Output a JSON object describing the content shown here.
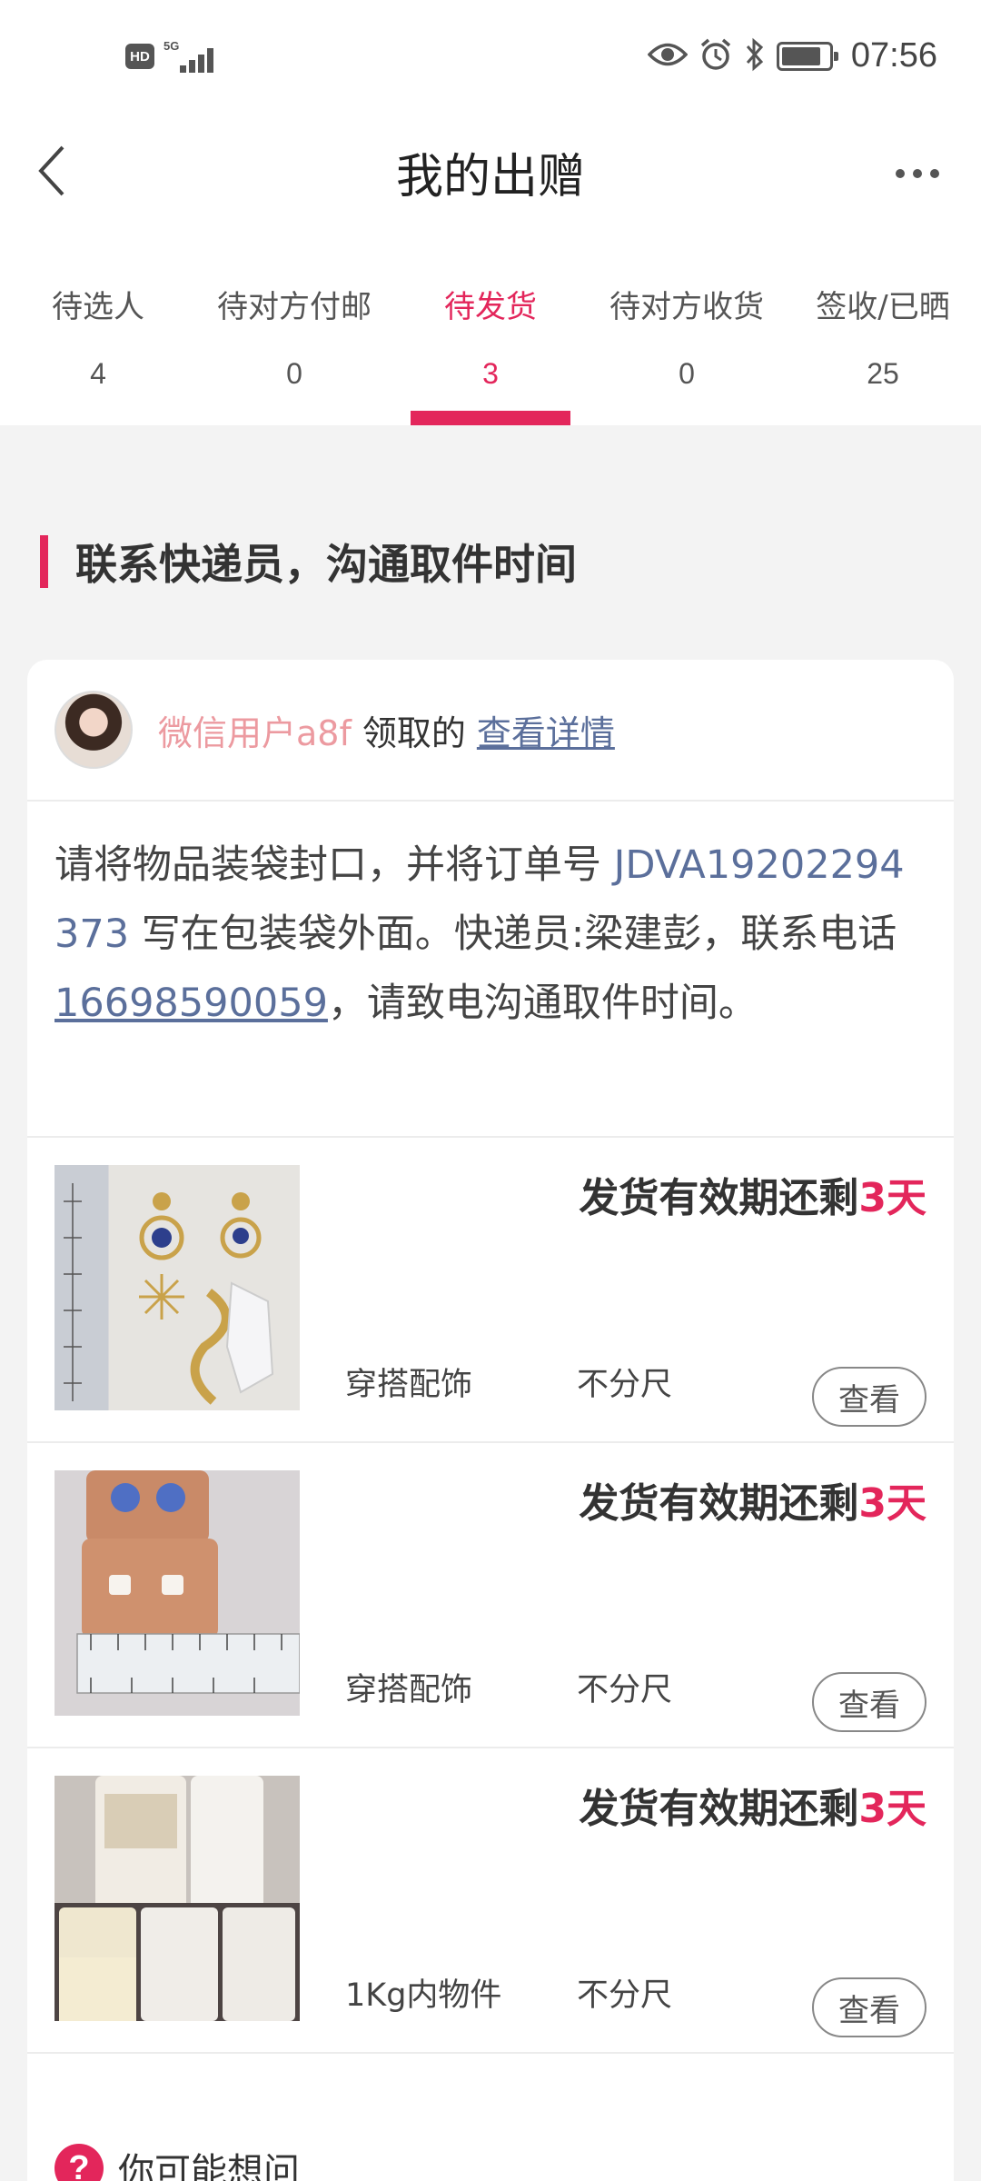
{
  "status_bar": {
    "hd_label": "HD",
    "network_label": "5G",
    "time": "07:56",
    "icons": [
      "eye-icon",
      "alarm-icon",
      "bluetooth-icon",
      "battery-icon"
    ]
  },
  "header": {
    "title": "我的出赠",
    "back_icon": "chevron-left-icon",
    "more_icon": "more-dots-icon"
  },
  "tabs": [
    {
      "label": "待选人",
      "count": "4",
      "active": false
    },
    {
      "label": "待对方付邮",
      "count": "0",
      "active": false
    },
    {
      "label": "待发货",
      "count": "3",
      "active": true
    },
    {
      "label": "待对方收货",
      "count": "0",
      "active": false
    },
    {
      "label": "签收/已晒",
      "count": "25",
      "active": false
    }
  ],
  "section": {
    "heading": "联系快递员，沟通取件时间"
  },
  "order": {
    "username": "微信用户a8f",
    "claimed_text": "领取的",
    "detail_link": "查看详情",
    "instruction_pre": "请将物品装袋封口，并将订单号 ",
    "order_number": "JDVA19202294373",
    "instruction_mid": " 写在包装袋外面。快递员:梁建彭，联系电话",
    "phone": "16698590059",
    "instruction_post": "，请致电沟通取件时间。"
  },
  "items": [
    {
      "deadline_prefix": "发货有效期还剩",
      "deadline_days": "3天",
      "category": "穿搭配饰",
      "size": "不分尺",
      "view_label": "查看"
    },
    {
      "deadline_prefix": "发货有效期还剩",
      "deadline_days": "3天",
      "category": "穿搭配饰",
      "size": "不分尺",
      "view_label": "查看"
    },
    {
      "deadline_prefix": "发货有效期还剩",
      "deadline_days": "3天",
      "category": "1Kg内物件",
      "size": "不分尺",
      "view_label": "查看"
    }
  ],
  "faq": {
    "label": "你可能想问",
    "icon": "question-circle-icon"
  },
  "colors": {
    "accent": "#e3265b",
    "link": "#5b6f9b",
    "username": "#ec9aa0"
  }
}
